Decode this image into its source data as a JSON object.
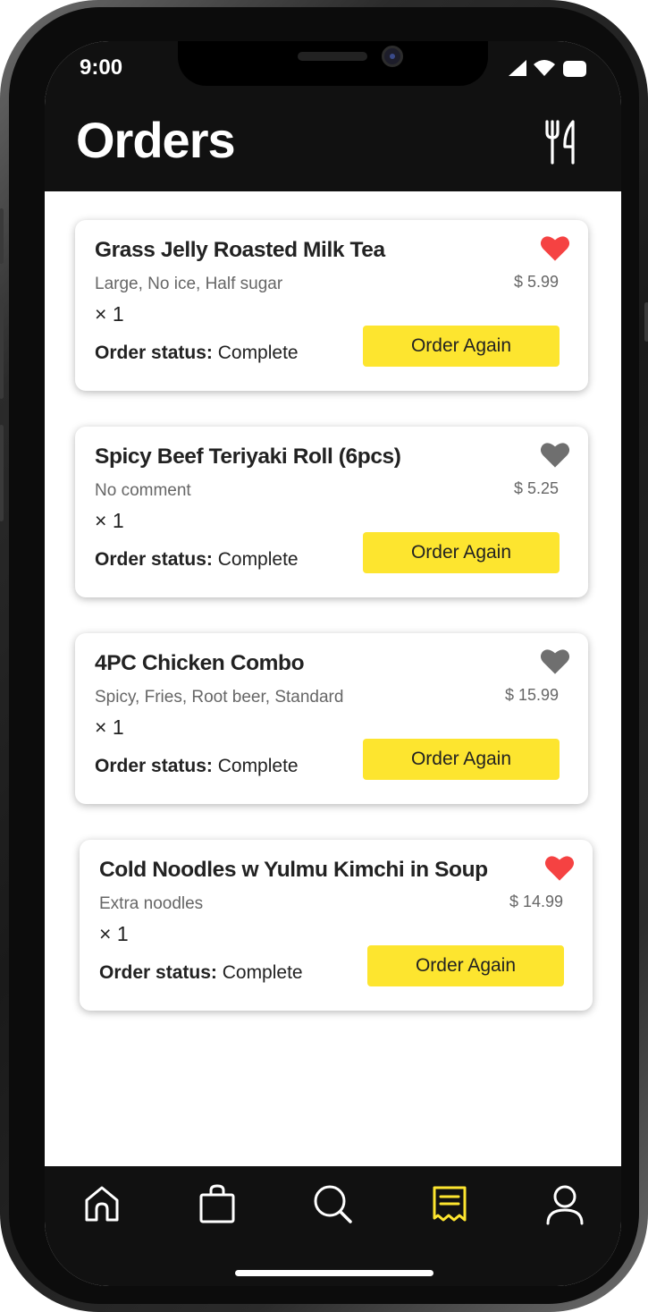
{
  "status_bar": {
    "time": "9:00",
    "icons": [
      "signal-icon",
      "wifi-icon",
      "battery-icon"
    ]
  },
  "header": {
    "title": "Orders",
    "menu_icon": "fork-knife-icon"
  },
  "orders": [
    {
      "name": "Grass Jelly Roasted Milk Tea",
      "options": "Large, No ice, Half sugar",
      "quantity": "× 1",
      "price": "$ 5.99",
      "status_label": "Order status:",
      "status_value": "Complete",
      "button_label": "Order Again",
      "favorite": true
    },
    {
      "name": "Spicy Beef Teriyaki Roll (6pcs)",
      "options": "No comment",
      "quantity": "× 1",
      "price": "$ 5.25",
      "status_label": "Order status:",
      "status_value": "Complete",
      "button_label": "Order Again",
      "favorite": false
    },
    {
      "name": "4PC Chicken Combo",
      "options": "Spicy, Fries, Root beer, Standard",
      "quantity": "× 1",
      "price": "$ 15.99",
      "status_label": "Order status:",
      "status_value": "Complete",
      "button_label": "Order Again",
      "favorite": false
    },
    {
      "name": "Cold Noodles w Yulmu Kimchi in Soup",
      "options": "Extra noodles",
      "quantity": "× 1",
      "price": "$ 14.99",
      "status_label": "Order status:",
      "status_value": "Complete",
      "button_label": "Order Again",
      "favorite": true
    }
  ],
  "bottom_nav": {
    "items": [
      "home-icon",
      "bag-icon",
      "search-icon",
      "receipt-icon",
      "user-icon"
    ],
    "active": "receipt-icon"
  },
  "colors": {
    "accent": "#fde52f",
    "bar_background": "#111111",
    "favorite_on": "#f54242",
    "favorite_off": "#6f6f6f",
    "nav_icon": "#ffffff"
  }
}
